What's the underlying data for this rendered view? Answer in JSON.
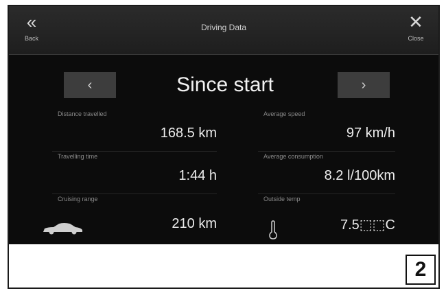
{
  "header": {
    "back_label": "Back",
    "back_icon": "double-chevron-left-icon",
    "title": "Driving Data",
    "close_label": "Close",
    "close_icon": "close-icon"
  },
  "period": {
    "label": "Since start",
    "prev_glyph": "‹",
    "next_glyph": "›"
  },
  "metrics": {
    "distance": {
      "label": "Distance travelled",
      "value": "168.5 km"
    },
    "avg_speed": {
      "label": "Average speed",
      "value": "97 km/h"
    },
    "travel_time": {
      "label": "Travelling time",
      "value": "1:44 h"
    },
    "avg_consumption": {
      "label": "Average consumption",
      "value": "8.2 l/100km"
    },
    "range": {
      "label": "Cruising range",
      "value": "210 km",
      "icon": "car-icon"
    },
    "outside_temp": {
      "label": "Outside temp",
      "value": "7.5⬚⬚C",
      "icon": "thermometer-icon"
    }
  },
  "figure_number": "2"
}
